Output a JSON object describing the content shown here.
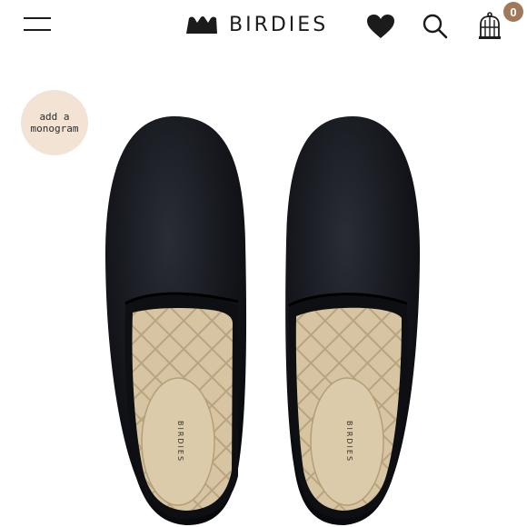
{
  "header": {
    "brand": "BIRDIES",
    "cart_count": "0"
  },
  "icons": {
    "menu": "hamburger-menu-icon",
    "brand_mark": "birdies-logo-icon",
    "favorites": "heart-icon",
    "search": "search-icon",
    "cart": "birdcage-cart-icon"
  },
  "product": {
    "monogram_line1": "add a",
    "monogram_line2": "monogram",
    "insole_brand": "BIRDIES"
  },
  "colors": {
    "badge_brown": "#a0795a",
    "monogram_bg": "#f2e3d5",
    "velvet": "#15171d",
    "insole": "#d8c6a3"
  }
}
